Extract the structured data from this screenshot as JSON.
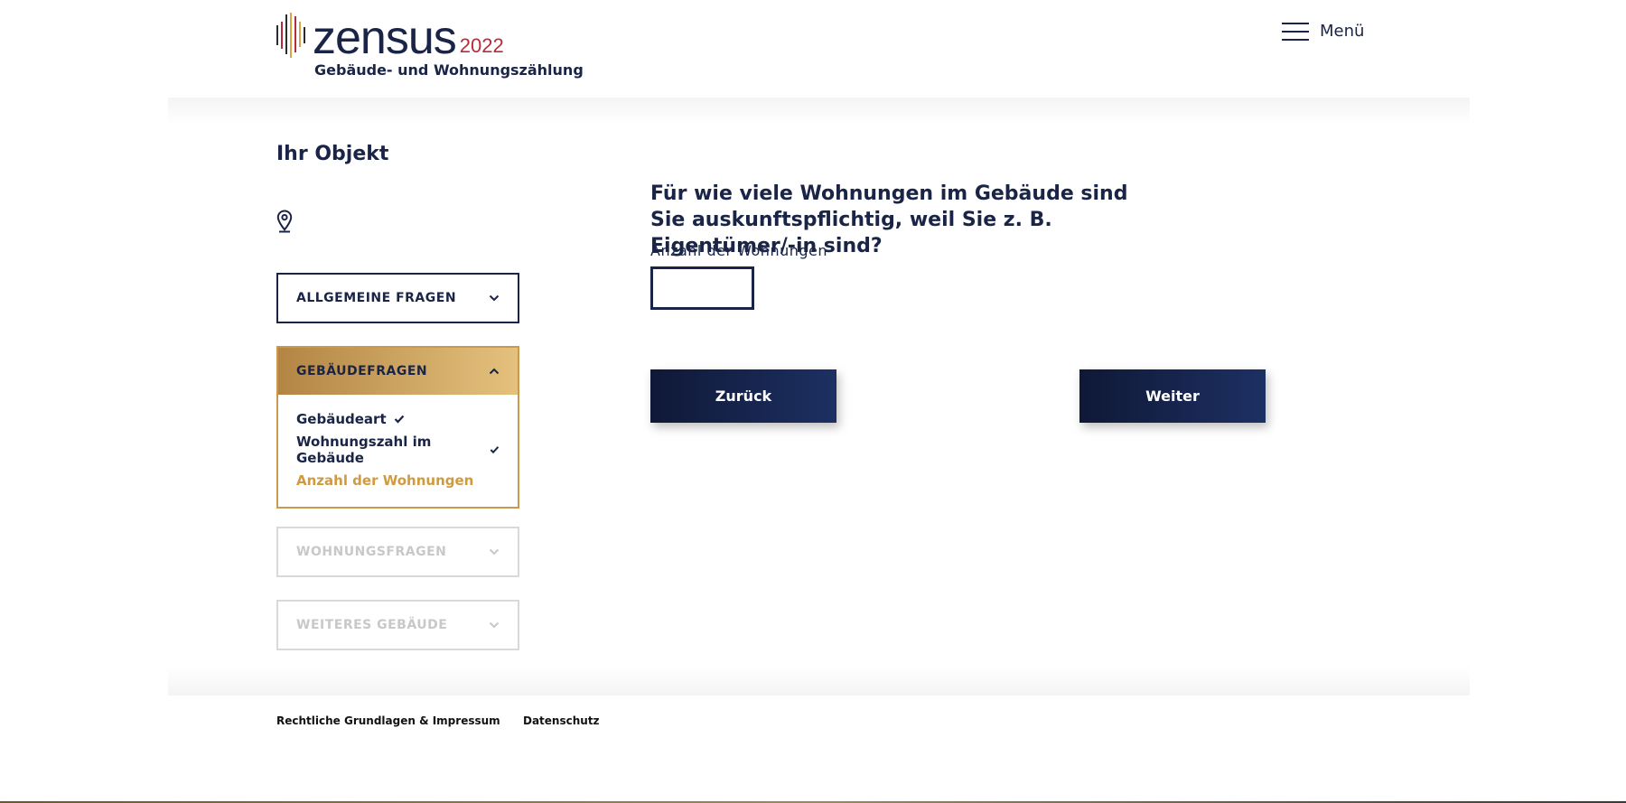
{
  "header": {
    "logo_word": "zensus",
    "logo_year": "2022",
    "subtitle": "Gebäude- und Wohnungszählung",
    "menu_label": "Menü"
  },
  "sidebar": {
    "title": "Ihr Objekt",
    "sections": [
      {
        "label": "Allgemeine Fragen",
        "state": "collapsed"
      },
      {
        "label": "Gebäudefragen",
        "state": "expanded",
        "items": [
          {
            "label": "Gebäudeart",
            "done": true
          },
          {
            "label": "Wohnungszahl im Gebäude",
            "done": true
          },
          {
            "label": "Anzahl der Wohnungen",
            "current": true
          }
        ]
      },
      {
        "label": "Wohnungsfragen",
        "state": "disabled"
      },
      {
        "label": "Weiteres Gebäude",
        "state": "disabled"
      }
    ]
  },
  "question": {
    "text": "Für wie viele Wohnungen im Gebäude sind Sie auskunftspflichtig, weil Sie z. B. Eigentümer/-in sind?",
    "field_label": "Anzahl der Wohnungen",
    "field_value": ""
  },
  "buttons": {
    "back": "Zurück",
    "next": "Weiter"
  },
  "footer": {
    "legal": "Rechtliche Grundlagen & Impressum",
    "privacy": "Datenschutz"
  },
  "colors": {
    "navy": "#1a2446",
    "gold": "#c99a4d",
    "current_item": "#d09a3f",
    "disabled": "#c8c8c8"
  }
}
